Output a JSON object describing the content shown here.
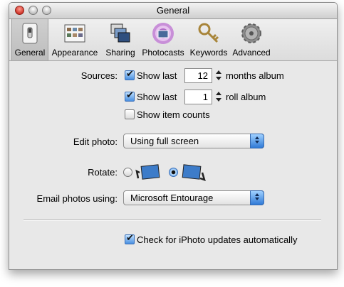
{
  "window": {
    "title": "General"
  },
  "toolbar": {
    "items": [
      {
        "label": "General",
        "icon": "switch-icon",
        "selected": true
      },
      {
        "label": "Appearance",
        "icon": "appearance-icon",
        "selected": false
      },
      {
        "label": "Sharing",
        "icon": "sharing-icon",
        "selected": false
      },
      {
        "label": "Photocasts",
        "icon": "photocasts-icon",
        "selected": false
      },
      {
        "label": "Keywords",
        "icon": "key-icon",
        "selected": false
      },
      {
        "label": "Advanced",
        "icon": "gear-icon",
        "selected": false
      }
    ]
  },
  "sources": {
    "label": "Sources:",
    "months": {
      "checked": true,
      "prefix": "Show last",
      "value": "12",
      "suffix": "months album"
    },
    "rolls": {
      "checked": true,
      "prefix": "Show last",
      "value": "1",
      "suffix": "roll album"
    },
    "counts": {
      "checked": false,
      "label": "Show item counts"
    }
  },
  "edit_photo": {
    "label": "Edit photo:",
    "value": "Using full screen"
  },
  "rotate": {
    "label": "Rotate:",
    "selected": "clockwise"
  },
  "email": {
    "label": "Email photos using:",
    "value": "Microsoft Entourage"
  },
  "updates": {
    "checked": true,
    "label": "Check for iPhoto updates automatically"
  },
  "colors": {
    "accent": "#3a7bd5",
    "window_bg": "#e8e8e8"
  }
}
